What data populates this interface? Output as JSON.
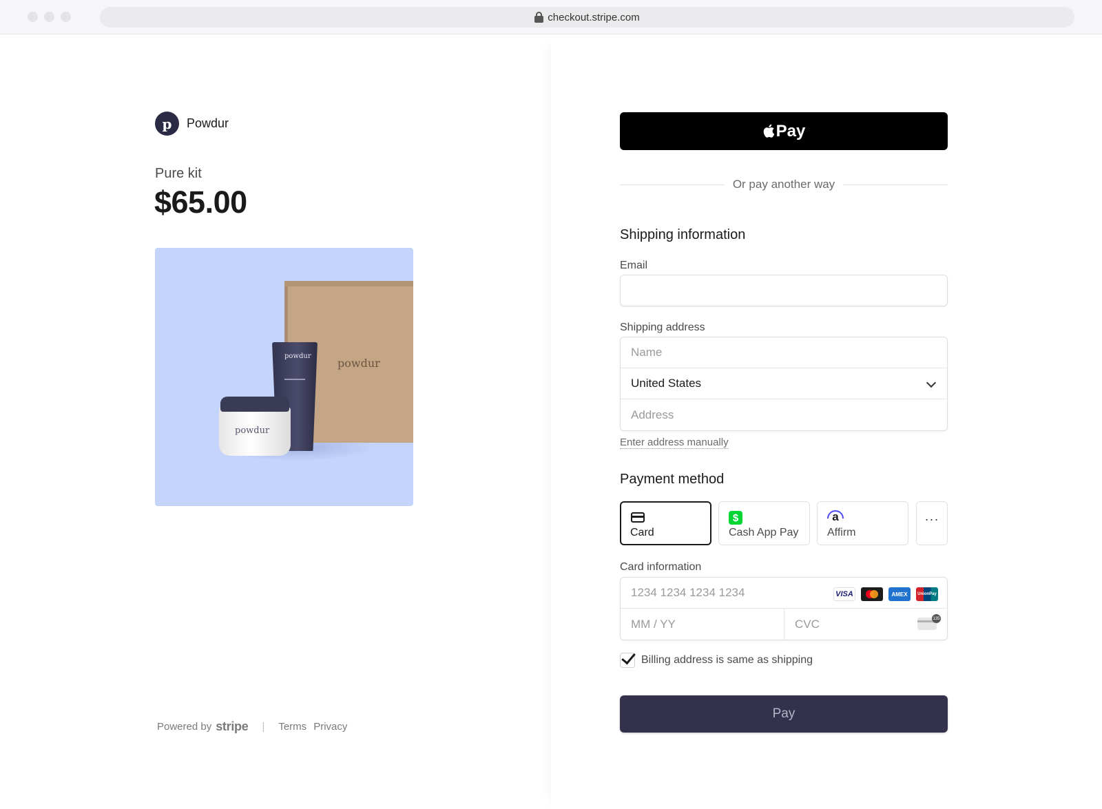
{
  "browser": {
    "url": "checkout.stripe.com"
  },
  "merchant": {
    "logo_letter": "p",
    "name": "Powdur"
  },
  "product": {
    "name": "Pure kit",
    "price": "$65.00",
    "image": {
      "background_color": "#c5d4fb",
      "box_text": "powdur",
      "tube_text": "powdur",
      "jar_text": "powdur"
    }
  },
  "footer": {
    "powered_by": "Powered by",
    "stripe": "stripe",
    "separator": "|",
    "terms": "Terms",
    "privacy": "Privacy"
  },
  "apple_pay": {
    "label": "Pay",
    "icon": "apple-icon"
  },
  "divider_text": "Or pay another way",
  "shipping": {
    "title": "Shipping information",
    "email_label": "Email",
    "email_value": "",
    "address_label": "Shipping address",
    "name_placeholder": "Name",
    "country": "United States",
    "address_placeholder": "Address",
    "manual_link": "Enter address manually"
  },
  "payment": {
    "title": "Payment method",
    "methods": [
      {
        "label": "Card",
        "icon": "card-icon",
        "selected": true
      },
      {
        "label": "Cash App Pay",
        "icon": "cash-app-icon",
        "selected": false
      },
      {
        "label": "Affirm",
        "icon": "affirm-icon",
        "selected": false
      },
      {
        "label": "···",
        "icon": "more-icon",
        "selected": false
      }
    ],
    "card_info_label": "Card information",
    "card_number_placeholder": "1234 1234 1234 1234",
    "expiry_placeholder": "MM / YY",
    "cvc_placeholder": "CVC",
    "card_brands": [
      "VISA",
      "Mastercard",
      "AMEX",
      "UnionPay"
    ],
    "cvc_badge": "135",
    "billing_same_label": "Billing address is same as shipping",
    "billing_same_checked": true
  },
  "pay_button": "Pay",
  "colors": {
    "pay_button": "#33314c",
    "brand_logo": "#2b2a44",
    "apple_pay": "#000000"
  }
}
